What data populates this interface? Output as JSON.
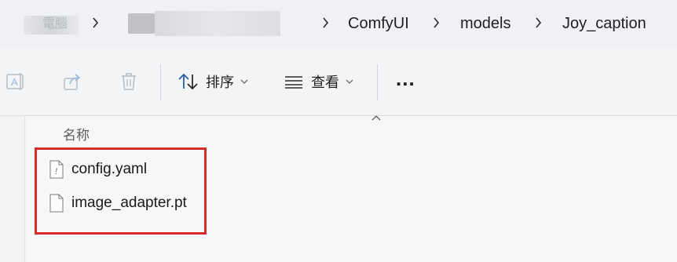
{
  "breadcrumb": {
    "items": [
      "ComfyUI",
      "models",
      "Joy_caption"
    ],
    "redacted_fragment": "電腦"
  },
  "toolbar": {
    "rename_icon": "rename-icon",
    "share_icon": "share-icon",
    "delete_icon": "trash-icon",
    "sort_label": "排序",
    "view_label": "查看",
    "more_label": "..."
  },
  "file_list": {
    "column_header": "名称",
    "files": [
      {
        "name": "config.yaml",
        "icon": "yaml-file-icon"
      },
      {
        "name": "image_adapter.pt",
        "icon": "file-icon"
      }
    ]
  },
  "colors": {
    "highlight_border": "#d42b2b",
    "toolbar_bg": "#f3f4f6",
    "address_bg": "#eff1f4",
    "yaml_mark": "#7a4cb0"
  }
}
